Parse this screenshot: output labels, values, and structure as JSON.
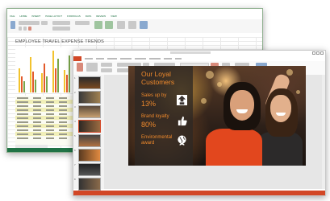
{
  "excel": {
    "ribbon_tabs": [
      "FILE",
      "HOME",
      "INSERT",
      "PAGE LAYOUT",
      "FORMULAS",
      "DATA",
      "REVIEW",
      "VIEW"
    ],
    "sheet_title": "EMPLOYEE TRAVEL EXPENSE TRENDS",
    "accent_color": "#217346"
  },
  "powerpoint": {
    "accent_color": "#d24726",
    "slide_numbers": [
      "1",
      "2",
      "3",
      "4",
      "5",
      "6",
      "7",
      "8"
    ],
    "slide": {
      "title_line1": "Our Loyal",
      "title_line2": "Customers",
      "stat1_label": "Sales up by",
      "stat1_value": "13%",
      "stat2_label": "Brand loyalty",
      "stat2_value": "80%",
      "stat3_label_line1": "Environmental",
      "stat3_label_line2": "award",
      "icons": [
        "dollar-up-icon",
        "thumbs-up-icon",
        "globe-award-icon"
      ],
      "text_color": "#f08a2c"
    }
  }
}
